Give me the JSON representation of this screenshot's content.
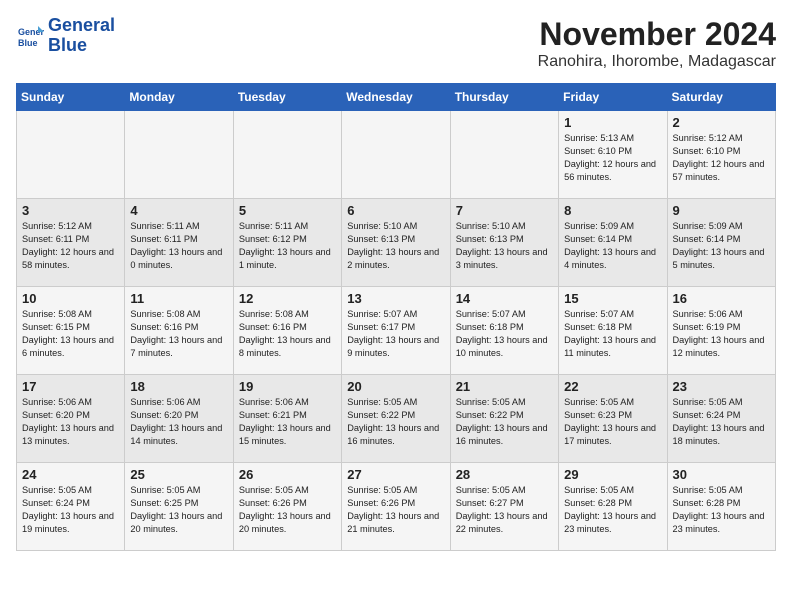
{
  "logo": {
    "line1": "General",
    "line2": "Blue"
  },
  "title": "November 2024",
  "location": "Ranohira, Ihorombe, Madagascar",
  "days_of_week": [
    "Sunday",
    "Monday",
    "Tuesday",
    "Wednesday",
    "Thursday",
    "Friday",
    "Saturday"
  ],
  "weeks": [
    [
      {
        "day": "",
        "info": ""
      },
      {
        "day": "",
        "info": ""
      },
      {
        "day": "",
        "info": ""
      },
      {
        "day": "",
        "info": ""
      },
      {
        "day": "",
        "info": ""
      },
      {
        "day": "1",
        "info": "Sunrise: 5:13 AM\nSunset: 6:10 PM\nDaylight: 12 hours and 56 minutes."
      },
      {
        "day": "2",
        "info": "Sunrise: 5:12 AM\nSunset: 6:10 PM\nDaylight: 12 hours and 57 minutes."
      }
    ],
    [
      {
        "day": "3",
        "info": "Sunrise: 5:12 AM\nSunset: 6:11 PM\nDaylight: 12 hours and 58 minutes."
      },
      {
        "day": "4",
        "info": "Sunrise: 5:11 AM\nSunset: 6:11 PM\nDaylight: 13 hours and 0 minutes."
      },
      {
        "day": "5",
        "info": "Sunrise: 5:11 AM\nSunset: 6:12 PM\nDaylight: 13 hours and 1 minute."
      },
      {
        "day": "6",
        "info": "Sunrise: 5:10 AM\nSunset: 6:13 PM\nDaylight: 13 hours and 2 minutes."
      },
      {
        "day": "7",
        "info": "Sunrise: 5:10 AM\nSunset: 6:13 PM\nDaylight: 13 hours and 3 minutes."
      },
      {
        "day": "8",
        "info": "Sunrise: 5:09 AM\nSunset: 6:14 PM\nDaylight: 13 hours and 4 minutes."
      },
      {
        "day": "9",
        "info": "Sunrise: 5:09 AM\nSunset: 6:14 PM\nDaylight: 13 hours and 5 minutes."
      }
    ],
    [
      {
        "day": "10",
        "info": "Sunrise: 5:08 AM\nSunset: 6:15 PM\nDaylight: 13 hours and 6 minutes."
      },
      {
        "day": "11",
        "info": "Sunrise: 5:08 AM\nSunset: 6:16 PM\nDaylight: 13 hours and 7 minutes."
      },
      {
        "day": "12",
        "info": "Sunrise: 5:08 AM\nSunset: 6:16 PM\nDaylight: 13 hours and 8 minutes."
      },
      {
        "day": "13",
        "info": "Sunrise: 5:07 AM\nSunset: 6:17 PM\nDaylight: 13 hours and 9 minutes."
      },
      {
        "day": "14",
        "info": "Sunrise: 5:07 AM\nSunset: 6:18 PM\nDaylight: 13 hours and 10 minutes."
      },
      {
        "day": "15",
        "info": "Sunrise: 5:07 AM\nSunset: 6:18 PM\nDaylight: 13 hours and 11 minutes."
      },
      {
        "day": "16",
        "info": "Sunrise: 5:06 AM\nSunset: 6:19 PM\nDaylight: 13 hours and 12 minutes."
      }
    ],
    [
      {
        "day": "17",
        "info": "Sunrise: 5:06 AM\nSunset: 6:20 PM\nDaylight: 13 hours and 13 minutes."
      },
      {
        "day": "18",
        "info": "Sunrise: 5:06 AM\nSunset: 6:20 PM\nDaylight: 13 hours and 14 minutes."
      },
      {
        "day": "19",
        "info": "Sunrise: 5:06 AM\nSunset: 6:21 PM\nDaylight: 13 hours and 15 minutes."
      },
      {
        "day": "20",
        "info": "Sunrise: 5:05 AM\nSunset: 6:22 PM\nDaylight: 13 hours and 16 minutes."
      },
      {
        "day": "21",
        "info": "Sunrise: 5:05 AM\nSunset: 6:22 PM\nDaylight: 13 hours and 16 minutes."
      },
      {
        "day": "22",
        "info": "Sunrise: 5:05 AM\nSunset: 6:23 PM\nDaylight: 13 hours and 17 minutes."
      },
      {
        "day": "23",
        "info": "Sunrise: 5:05 AM\nSunset: 6:24 PM\nDaylight: 13 hours and 18 minutes."
      }
    ],
    [
      {
        "day": "24",
        "info": "Sunrise: 5:05 AM\nSunset: 6:24 PM\nDaylight: 13 hours and 19 minutes."
      },
      {
        "day": "25",
        "info": "Sunrise: 5:05 AM\nSunset: 6:25 PM\nDaylight: 13 hours and 20 minutes."
      },
      {
        "day": "26",
        "info": "Sunrise: 5:05 AM\nSunset: 6:26 PM\nDaylight: 13 hours and 20 minutes."
      },
      {
        "day": "27",
        "info": "Sunrise: 5:05 AM\nSunset: 6:26 PM\nDaylight: 13 hours and 21 minutes."
      },
      {
        "day": "28",
        "info": "Sunrise: 5:05 AM\nSunset: 6:27 PM\nDaylight: 13 hours and 22 minutes."
      },
      {
        "day": "29",
        "info": "Sunrise: 5:05 AM\nSunset: 6:28 PM\nDaylight: 13 hours and 23 minutes."
      },
      {
        "day": "30",
        "info": "Sunrise: 5:05 AM\nSunset: 6:28 PM\nDaylight: 13 hours and 23 minutes."
      }
    ]
  ]
}
